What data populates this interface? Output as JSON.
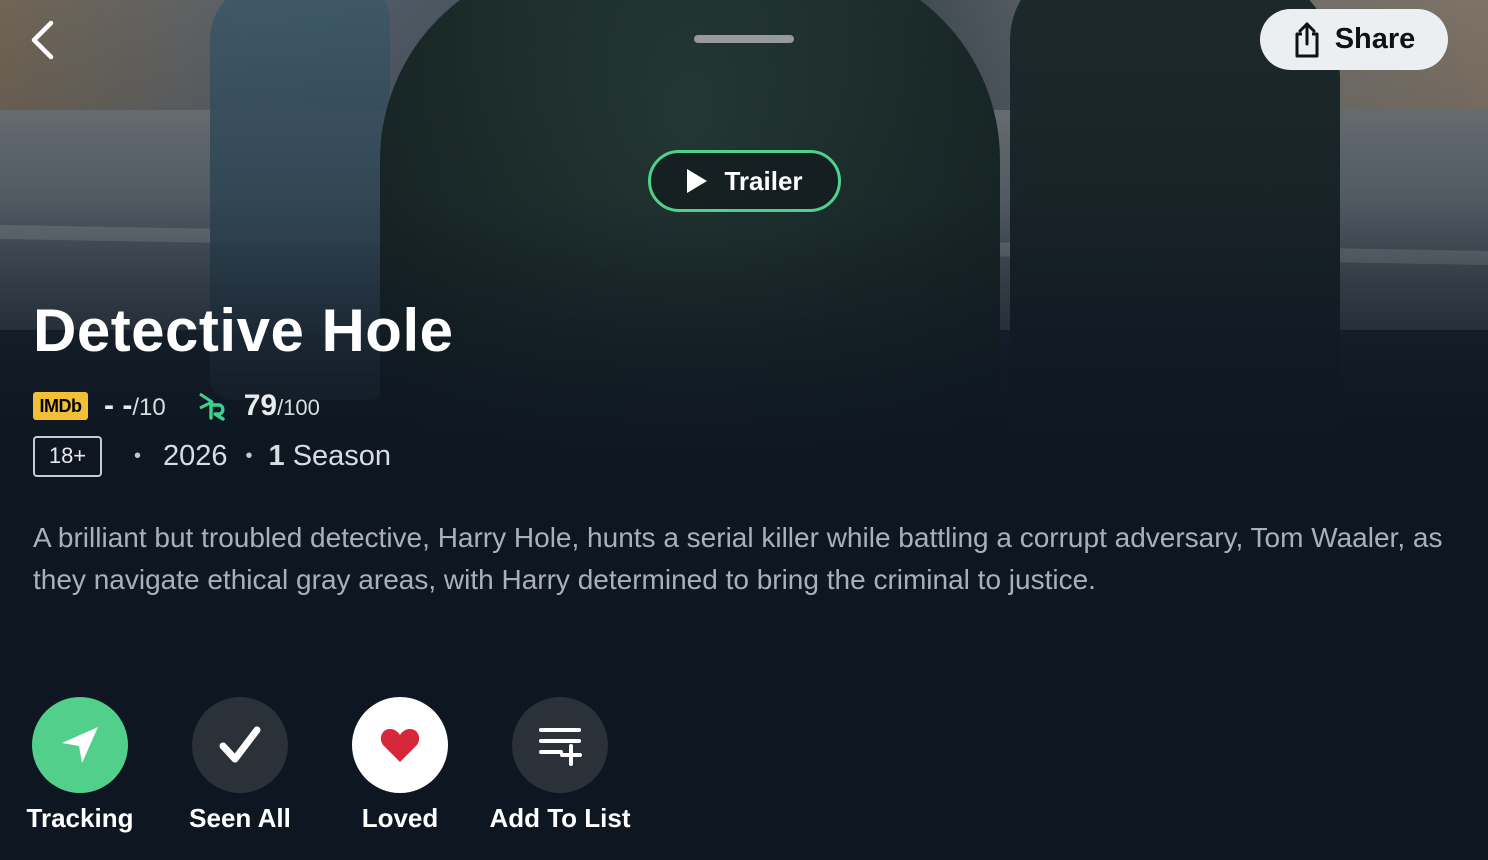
{
  "header": {
    "back_icon": "chevron-left-icon",
    "share_label": "Share",
    "share_icon": "share-icon"
  },
  "trailer": {
    "label": "Trailer",
    "icon": "play-icon",
    "accent": "#4fd18b"
  },
  "show": {
    "title": "Detective Hole",
    "imdb": {
      "badge": "IMDb",
      "value": "- -",
      "scale": "/10"
    },
    "reelgood": {
      "icon": "reelgood-logo",
      "value": "79",
      "scale": "/100",
      "accent": "#3fcf8e"
    },
    "age_rating": "18+",
    "year": "2026",
    "season_count": "1",
    "season_label": "Season",
    "description": "A brilliant but troubled detective, Harry Hole, hunts a serial killer while battling a corrupt adversary, Tom Waaler, as they navigate ethical gray areas, with Harry determined to bring the criminal to justice."
  },
  "actions": [
    {
      "label": "Tracking",
      "icon": "paper-plane-icon",
      "bg": "#53cf8c"
    },
    {
      "label": "Seen All",
      "icon": "checkmark-icon",
      "bg": "#2a3139"
    },
    {
      "label": "Loved",
      "icon": "heart-icon",
      "bg": "#ffffff",
      "icon_color": "#d6283a"
    },
    {
      "label": "Add To List",
      "icon": "add-to-list-icon",
      "bg": "#2a3139"
    }
  ]
}
